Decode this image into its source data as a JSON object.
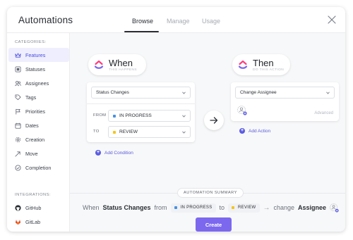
{
  "header": {
    "title": "Automations",
    "tabs": [
      {
        "label": "Browse",
        "active": true
      },
      {
        "label": "Manage",
        "active": false
      },
      {
        "label": "Usage",
        "active": false
      }
    ]
  },
  "sidebar": {
    "categories_title": "CATEGORIES:",
    "categories": [
      {
        "label": "Features",
        "icon": "crown-icon",
        "active": true
      },
      {
        "label": "Statuses",
        "icon": "status-icon"
      },
      {
        "label": "Assignees",
        "icon": "people-icon"
      },
      {
        "label": "Tags",
        "icon": "tag-icon"
      },
      {
        "label": "Priorities",
        "icon": "flag-icon"
      },
      {
        "label": "Dates",
        "icon": "calendar-icon"
      },
      {
        "label": "Creation",
        "icon": "gear-icon"
      },
      {
        "label": "Move",
        "icon": "move-icon"
      },
      {
        "label": "Completion",
        "icon": "check-circle-icon"
      }
    ],
    "integrations_title": "INTEGRATIONS:",
    "integrations": [
      {
        "label": "GitHub",
        "icon": "github-icon"
      },
      {
        "label": "GitLab",
        "icon": "gitlab-icon"
      }
    ]
  },
  "when": {
    "title": "When",
    "subtitle": "THIS HAPPENS",
    "trigger": "Status Changes",
    "from_label": "FROM",
    "from_value": "IN PROGRESS",
    "to_label": "TO",
    "to_value": "REVIEW",
    "add_condition": "Add Condition"
  },
  "then": {
    "title": "Then",
    "subtitle": "DO THIS ACTION",
    "action": "Change Assignee",
    "advanced": "Advanced",
    "add_action": "Add Action"
  },
  "summary": {
    "badge": "AUTOMATION SUMMARY",
    "when_word": "When",
    "trigger": "Status Changes",
    "from_word": "from",
    "from_chip": "IN PROGRESS",
    "to_word": "to",
    "to_chip": "REVIEW",
    "arrow": "→",
    "change_word": "change",
    "target": "Assignee"
  },
  "create_button": "Create",
  "colors": {
    "accent": "#7b68ee",
    "in_progress": "#4a90e2",
    "review": "#f5c518",
    "active_nav_bg": "#eeeefe"
  }
}
